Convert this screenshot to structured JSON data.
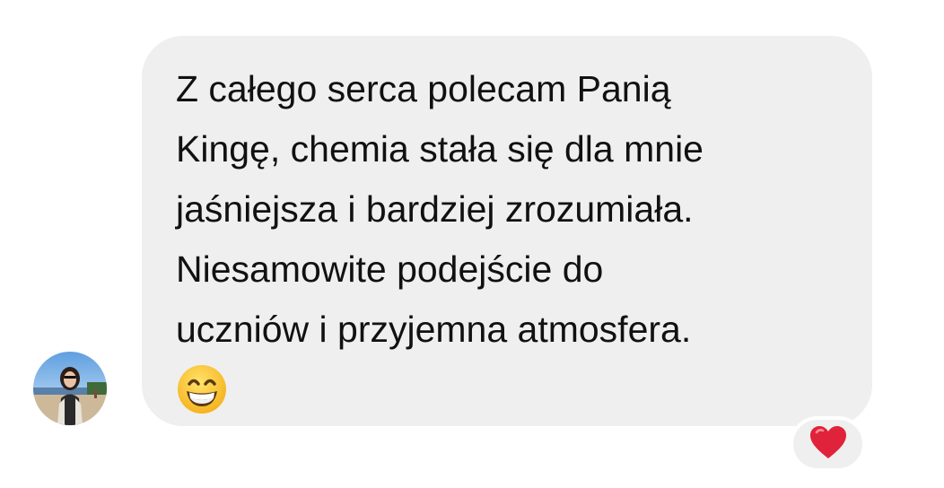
{
  "message": {
    "text": "Z całego serca polecam Panią\nKingę, chemia stała się dla mnie\njaśniejsza i bardziej zrozumiała.\nNiesamowite podejście do\nuczniów i przyjemna atmosfera.",
    "emoji": "grinning-face-with-smiling-eyes",
    "bubble_color": "#efefef"
  },
  "sender": {
    "avatar": "user-avatar-photo"
  },
  "reaction": {
    "icon": "red-heart",
    "color": "#e0233a"
  }
}
